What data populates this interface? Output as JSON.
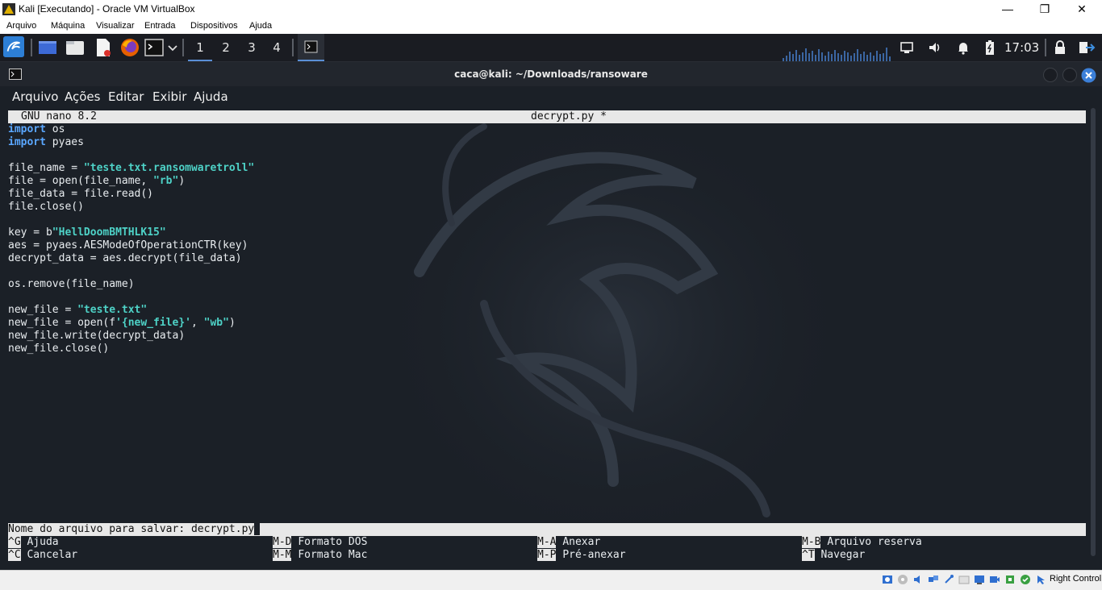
{
  "vbox": {
    "title": "Kali [Executando] - Oracle VM VirtualBox",
    "menu": [
      "Arquivo",
      "Máquina",
      "Visualizar",
      "Entrada",
      "Dispositivos",
      "Ajuda"
    ],
    "window_controls": {
      "minimize": "—",
      "restore": "❐",
      "close": "✕"
    },
    "host_key": "Right Control"
  },
  "panel": {
    "workspaces": [
      "1",
      "2",
      "3",
      "4"
    ],
    "active_workspace": "1",
    "clock": "17:03",
    "icons": [
      "kali-menu-icon",
      "show-desktop-icon",
      "file-manager-icon",
      "text-editor-icon",
      "firefox-icon",
      "terminal-icon",
      "network-icon",
      "volume-icon",
      "notifications-icon",
      "battery-icon",
      "lock-icon",
      "logout-icon"
    ]
  },
  "terminal": {
    "title": "caca@kali: ~/Downloads/ransoware",
    "menu": [
      "Arquivo",
      "Ações",
      "Editar",
      "Exibir",
      "Ajuda"
    ]
  },
  "nano": {
    "version": "GNU nano 8.2",
    "filename": "decrypt.py *",
    "code": [
      [
        {
          "t": "import",
          "c": "kw"
        },
        {
          "t": " os"
        }
      ],
      [
        {
          "t": "import",
          "c": "kw"
        },
        {
          "t": " pyaes"
        }
      ],
      [],
      [
        {
          "t": "file_name = "
        },
        {
          "t": "\"teste.txt.ransomwaretroll\"",
          "c": "str"
        }
      ],
      [
        {
          "t": "file = open(file_name, "
        },
        {
          "t": "\"rb\"",
          "c": "str"
        },
        {
          "t": ")"
        }
      ],
      [
        {
          "t": "file_data = file.read()"
        }
      ],
      [
        {
          "t": "file.close()"
        }
      ],
      [],
      [
        {
          "t": "key = b"
        },
        {
          "t": "\"HellDoomBMTHLK15\"",
          "c": "str"
        }
      ],
      [
        {
          "t": "aes = pyaes.AESModeOfOperationCTR(key)"
        }
      ],
      [
        {
          "t": "decrypt_data = aes.decrypt(file_data)"
        }
      ],
      [],
      [
        {
          "t": "os.remove(file_name)"
        }
      ],
      [],
      [
        {
          "t": "new_file = "
        },
        {
          "t": "\"teste.txt\"",
          "c": "str"
        }
      ],
      [
        {
          "t": "new_file = open(f"
        },
        {
          "t": "'{new_file}'",
          "c": "str"
        },
        {
          "t": ", "
        },
        {
          "t": "\"wb\"",
          "c": "str"
        },
        {
          "t": ")"
        }
      ],
      [
        {
          "t": "new_file.write(decrypt_data)"
        }
      ],
      [
        {
          "t": "new_file.close()"
        }
      ]
    ],
    "prompt": "Nome do arquivo para salvar: decrypt.py",
    "shortcuts": [
      {
        "key": "^G",
        "label": "Ajuda"
      },
      {
        "key": "M-D",
        "label": "Formato DOS"
      },
      {
        "key": "M-A",
        "label": "Anexar"
      },
      {
        "key": "M-B",
        "label": "Arquivo reserva"
      },
      {
        "key": "^C",
        "label": "Cancelar"
      },
      {
        "key": "M-M",
        "label": "Formato Mac"
      },
      {
        "key": "M-P",
        "label": "Pré-anexar"
      },
      {
        "key": "^T",
        "label": "Navegar"
      }
    ]
  },
  "colors": {
    "keyword": "#5aa7ff",
    "string": "#4ed2c7",
    "terminal_bg": "#1b2027",
    "panel_bg": "#1a1c22",
    "accent": "#5a8fd6"
  }
}
